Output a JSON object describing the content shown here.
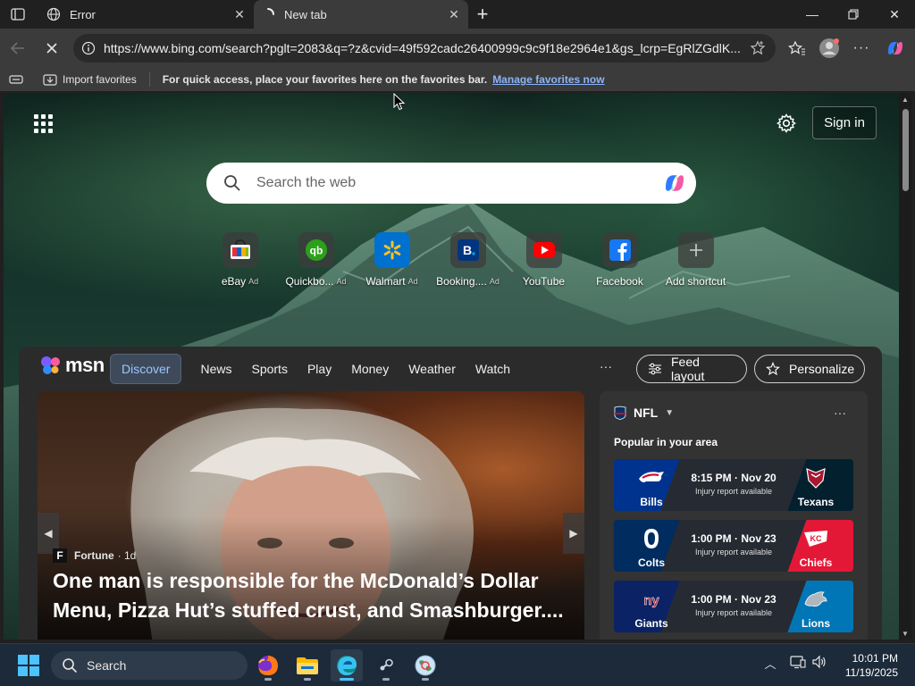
{
  "browser": {
    "tabs": [
      {
        "title": "Error"
      },
      {
        "title": "New tab"
      }
    ],
    "address": {
      "url": "https://www.bing.com/search?pglt=2083&q=?z&cvid=49f592cadc26400999c9c9f18e2964e1&gs_lcrp=EgRlZGdlK..."
    },
    "favorites_bar": {
      "import_label": "Import favorites",
      "hint": "For quick access, place your favorites here on the favorites bar.",
      "manage_link": "Manage favorites now"
    }
  },
  "newtab": {
    "signin_label": "Sign in",
    "search": {
      "placeholder": "Search the web"
    },
    "shortcuts": [
      {
        "label": "eBay",
        "ad": "Ad",
        "icon": "ebay-icon"
      },
      {
        "label": "Quickbo...",
        "ad": "Ad",
        "icon": "quickbooks-icon"
      },
      {
        "label": "Walmart",
        "ad": "Ad",
        "icon": "walmart-icon"
      },
      {
        "label": "Booking....",
        "ad": "Ad",
        "icon": "booking-icon"
      },
      {
        "label": "YouTube",
        "ad": "",
        "icon": "youtube-icon"
      },
      {
        "label": "Facebook",
        "ad": "",
        "icon": "facebook-icon"
      },
      {
        "label": "Add shortcut",
        "ad": "",
        "icon": "plus-icon"
      }
    ]
  },
  "feed": {
    "brand": "msn",
    "nav": [
      "Discover",
      "News",
      "Sports",
      "Play",
      "Money",
      "Weather",
      "Watch"
    ],
    "more": "···",
    "feed_layout_label": "Feed layout",
    "personalize_label": "Personalize",
    "hero": {
      "source": "Fortune",
      "age": "· 1d",
      "source_initial": "F",
      "title": "One man is responsible for the McDonald’s Dollar Menu, Pizza Hut’s stuffed crust, and Smashburger...."
    },
    "nfl": {
      "league": "NFL",
      "subtitle": "Popular in your area",
      "more": "···",
      "games": [
        {
          "home": "Bills",
          "away": "Texans",
          "time": "8:15 PM · Nov 20",
          "note": "Injury report available",
          "home_color": "#00338D",
          "away_color": "#03202F"
        },
        {
          "home": "Colts",
          "away": "Chiefs",
          "time": "1:00 PM · Nov 23",
          "note": "Injury report available",
          "home_color": "#002C5F",
          "away_color": "#E31837"
        },
        {
          "home": "Giants",
          "away": "Lions",
          "time": "1:00 PM · Nov 23",
          "note": "Injury report available",
          "home_color": "#0B2265",
          "away_color": "#0076B6"
        }
      ]
    }
  },
  "taskbar": {
    "search_label": "Search",
    "time": "10:01 PM",
    "date": "11/19/2025"
  },
  "colors": {
    "accent": "#4cc2ff",
    "link": "#8ab4f8"
  }
}
